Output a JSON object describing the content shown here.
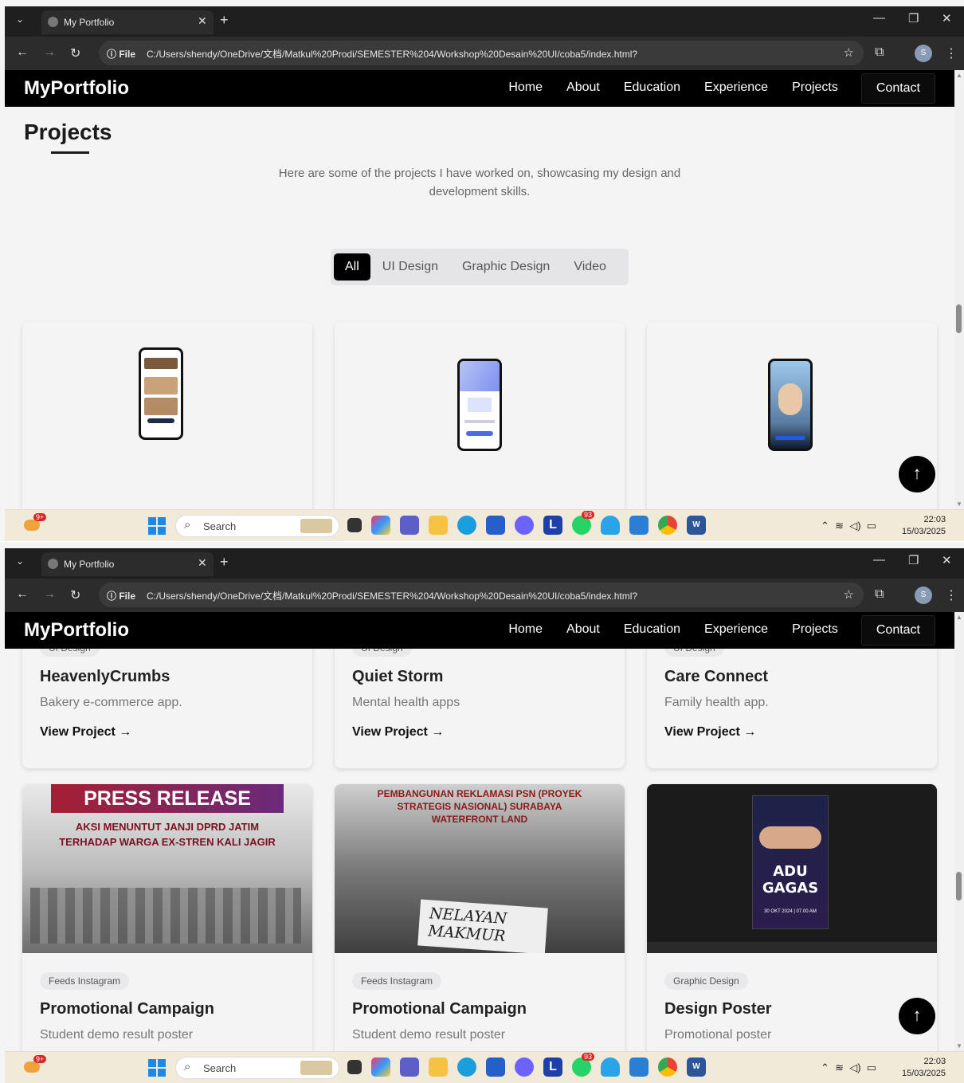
{
  "browser": {
    "tab_title": "My Portfolio",
    "info_label": "ⓘ File",
    "url": "C:/Users/shendy/OneDrive/文档/Matkul%20Prodi/SEMESTER%204/Workshop%20Desain%20UI/coba5/index.html?",
    "avatar_initial": "S"
  },
  "site": {
    "logo": "MyPortfolio",
    "nav": [
      "Home",
      "About",
      "Education",
      "Experience",
      "Projects",
      "Contact"
    ]
  },
  "projects": {
    "heading": "Projects",
    "description": "Here are some of the projects I have worked on, showcasing my design and development skills.",
    "filters": [
      "All",
      "UI Design",
      "Graphic Design",
      "Video"
    ],
    "active_filter": "All",
    "row1": [
      {
        "tag": "UI Design",
        "title": "HeavenlyCrumbs",
        "subtitle": "Bakery e-commerce app.",
        "link": "View Project →"
      },
      {
        "tag": "UI Design",
        "title": "Quiet Storm",
        "subtitle": "Mental health apps",
        "link": "View Project →"
      },
      {
        "tag": "UI Design",
        "title": "Care Connect",
        "subtitle": "Family health app.",
        "link": "View Project →"
      }
    ],
    "row2": [
      {
        "tag": "Feeds Instagram",
        "title": "Promotional Campaign",
        "subtitle": "Student demo result poster",
        "poster_banner": "PRESS RELEASE",
        "poster_line1": "AKSI MENUNTUT JANJI DPRD JATIM",
        "poster_line2": "TERHADAP WARGA EX-STREN KALI JAGIR"
      },
      {
        "tag": "Feeds Instagram",
        "title": "Promotional Campaign",
        "subtitle": "Student demo result poster",
        "poster_line1": "PEMBANGUNAN REKLAMASI PSN (PROYEK",
        "poster_line2": "STRATEGIS NASIONAL) SURABAYA",
        "poster_line3": "WATERFRONT LAND",
        "poster_sign": "NELAYAN MAKMUR"
      },
      {
        "tag": "Graphic Design",
        "title": "Design Poster",
        "subtitle": "Promotional poster",
        "poster_title": "ADU GAGAS",
        "poster_date": "30 OKT 2024 | 07.00 AM"
      }
    ]
  },
  "taskbar": {
    "search_label": "Search",
    "notif_badge": "9+",
    "whatsapp_badge": "93",
    "time": "22:03",
    "date": "15/03/2025"
  },
  "colors": {
    "nav_bg": "#000000",
    "page_bg": "#f4f4f5",
    "press_banner": "#9e2235",
    "poster_red": "#7a1020"
  }
}
